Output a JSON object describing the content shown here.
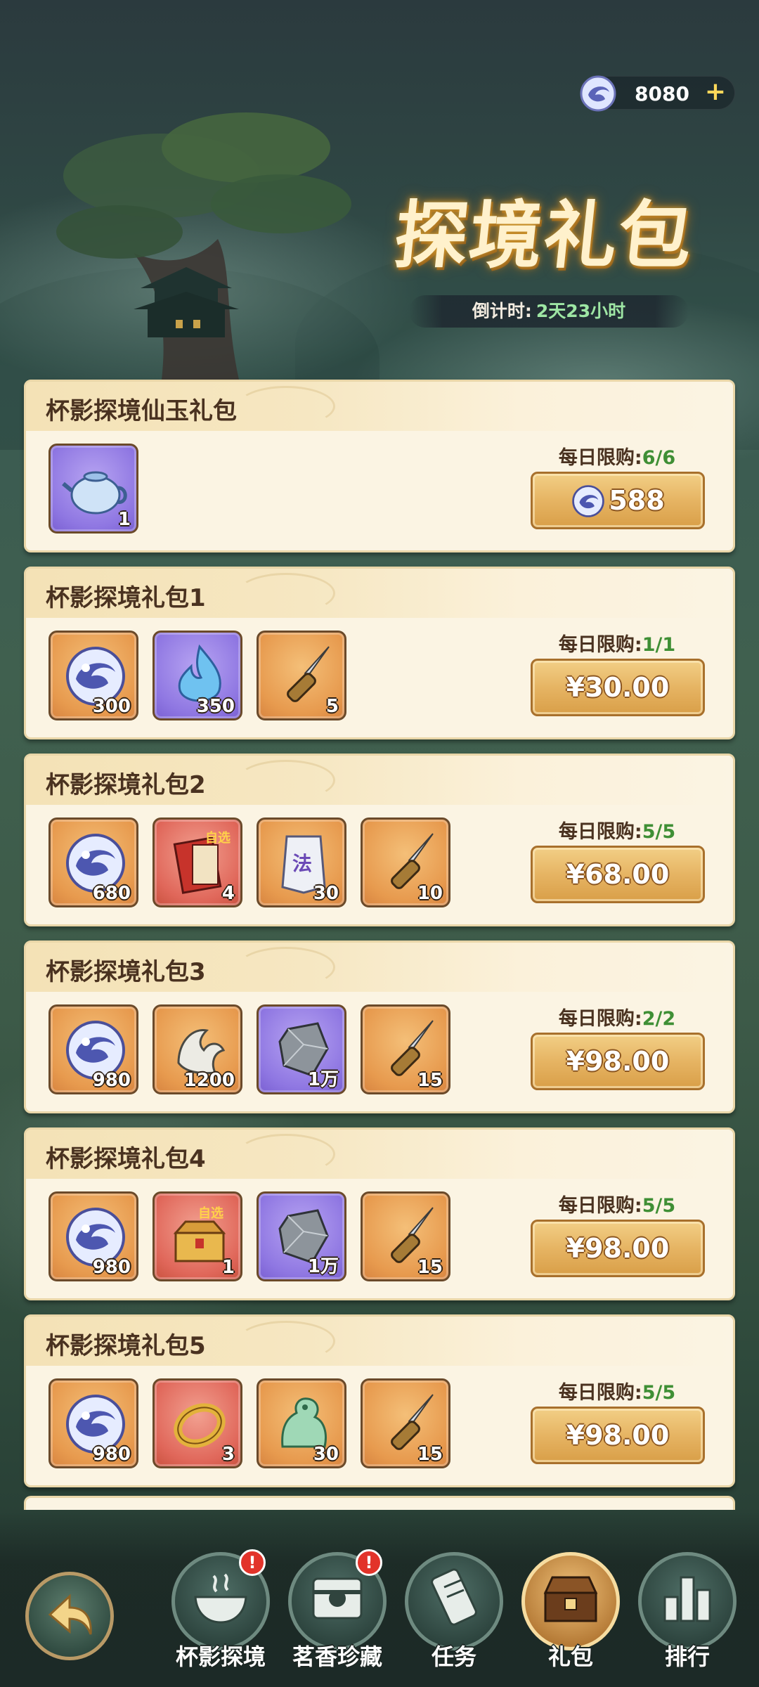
{
  "currency": {
    "amount": "8080",
    "plus": "+"
  },
  "title": "探境礼包",
  "countdown": {
    "label": "倒计时:",
    "value": "2天23小时"
  },
  "packs": [
    {
      "name": "杯影探境仙玉礼包",
      "limit_label": "每日限购:",
      "limit_value": "6/6",
      "price": "588",
      "price_is_gem": true,
      "items": [
        {
          "icon": "teapot-icon",
          "count": "1",
          "rarity": "purple"
        }
      ]
    },
    {
      "name": "杯影探境礼包1",
      "limit_label": "每日限购:",
      "limit_value": "1/1",
      "price": "¥30.00",
      "price_is_gem": false,
      "items": [
        {
          "icon": "jade-coin-icon",
          "count": "300",
          "rarity": "orange"
        },
        {
          "icon": "spirit-flame-icon",
          "count": "350",
          "rarity": "purple"
        },
        {
          "icon": "dagger-icon",
          "count": "5",
          "rarity": "orange"
        }
      ]
    },
    {
      "name": "杯影探境礼包2",
      "limit_label": "每日限购:",
      "limit_value": "5/5",
      "price": "¥68.00",
      "price_is_gem": false,
      "items": [
        {
          "icon": "jade-coin-icon",
          "count": "680",
          "rarity": "orange"
        },
        {
          "icon": "selectable-scroll-icon",
          "count": "4",
          "rarity": "red"
        },
        {
          "icon": "talisman-icon",
          "count": "30",
          "rarity": "orange"
        },
        {
          "icon": "dagger-icon",
          "count": "10",
          "rarity": "orange"
        }
      ]
    },
    {
      "name": "杯影探境礼包3",
      "limit_label": "每日限购:",
      "limit_value": "2/2",
      "price": "¥98.00",
      "price_is_gem": false,
      "items": [
        {
          "icon": "jade-coin-icon",
          "count": "980",
          "rarity": "orange"
        },
        {
          "icon": "bone-claw-icon",
          "count": "1200",
          "rarity": "orange"
        },
        {
          "icon": "iron-ore-icon",
          "count": "1万",
          "rarity": "purple"
        },
        {
          "icon": "dagger-icon",
          "count": "15",
          "rarity": "orange"
        }
      ]
    },
    {
      "name": "杯影探境礼包4",
      "limit_label": "每日限购:",
      "limit_value": "5/5",
      "price": "¥98.00",
      "price_is_gem": false,
      "items": [
        {
          "icon": "jade-coin-icon",
          "count": "980",
          "rarity": "orange"
        },
        {
          "icon": "selectable-chest-icon",
          "count": "1",
          "rarity": "red"
        },
        {
          "icon": "iron-ore-icon",
          "count": "1万",
          "rarity": "purple"
        },
        {
          "icon": "dagger-icon",
          "count": "15",
          "rarity": "orange"
        }
      ]
    },
    {
      "name": "杯影探境礼包5",
      "limit_label": "每日限购:",
      "limit_value": "5/5",
      "price": "¥98.00",
      "price_is_gem": false,
      "items": [
        {
          "icon": "jade-coin-icon",
          "count": "980",
          "rarity": "orange"
        },
        {
          "icon": "gold-ring-icon",
          "count": "3",
          "rarity": "red"
        },
        {
          "icon": "jade-lion-icon",
          "count": "30",
          "rarity": "orange"
        },
        {
          "icon": "dagger-icon",
          "count": "15",
          "rarity": "orange"
        }
      ]
    }
  ],
  "nav": {
    "items": [
      {
        "label": "杯影探境",
        "icon": "tea-bowl-icon",
        "badge": "!",
        "active": false
      },
      {
        "label": "茗香珍藏",
        "icon": "treasure-box-icon",
        "badge": "!",
        "active": false
      },
      {
        "label": "任务",
        "icon": "scroll-icon",
        "badge": "",
        "active": false
      },
      {
        "label": "礼包",
        "icon": "gift-chest-icon",
        "badge": "",
        "active": true
      },
      {
        "label": "排行",
        "icon": "ranking-icon",
        "badge": "",
        "active": false
      }
    ]
  },
  "colors": {
    "accent_gold": "#e6b463",
    "limit_green": "#3f8f35",
    "countdown_green": "#9ee6a4",
    "card_bg": "#fbf4e3"
  }
}
